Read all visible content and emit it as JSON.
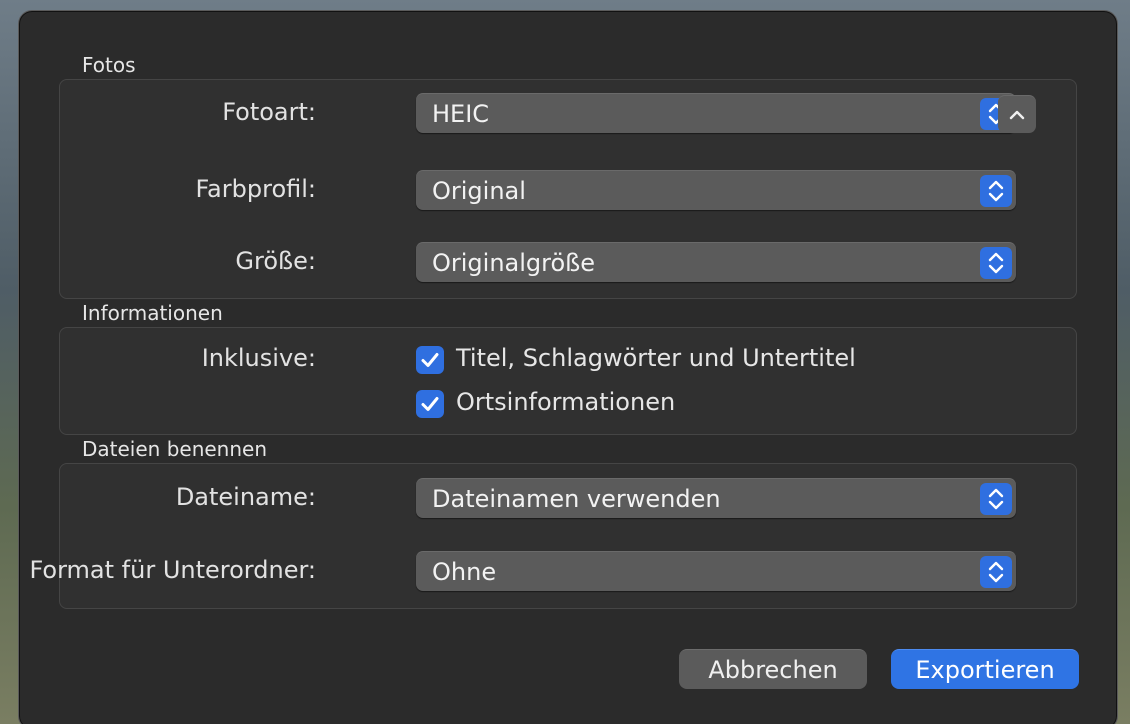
{
  "sections": {
    "photos": {
      "title": "Fotos",
      "photo_type_label": "Fotoart:",
      "photo_type_value": "HEIC",
      "color_profile_label": "Farbprofil:",
      "color_profile_value": "Original",
      "size_label": "Größe:",
      "size_value": "Originalgröße"
    },
    "info": {
      "title": "Informationen",
      "include_label": "Inklusive:",
      "option1": {
        "label": "Titel, Schlagwörter und Untertitel",
        "checked": true
      },
      "option2": {
        "label": "Ortsinformationen",
        "checked": true
      }
    },
    "naming": {
      "title": "Dateien benennen",
      "filename_label": "Dateiname:",
      "filename_value": "Dateinamen verwenden",
      "subfolder_label": "Format für Unterordner:",
      "subfolder_value": "Ohne"
    }
  },
  "buttons": {
    "cancel": "Abbrechen",
    "export": "Exportieren"
  },
  "colors": {
    "accent": "#2f74e4",
    "dialog_bg": "#2b2b2b",
    "popup_bg": "#5b5b5b"
  }
}
